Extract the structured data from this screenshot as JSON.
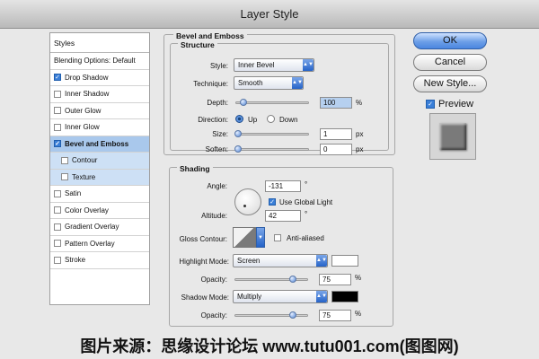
{
  "window": {
    "title": "Layer Style"
  },
  "styles_list": {
    "header": "Styles",
    "items": [
      {
        "label": "Blending Options: Default",
        "checkbox": false,
        "checked": false
      },
      {
        "label": "Drop Shadow",
        "checkbox": true,
        "checked": true
      },
      {
        "label": "Inner Shadow",
        "checkbox": true,
        "checked": false
      },
      {
        "label": "Outer Glow",
        "checkbox": true,
        "checked": false
      },
      {
        "label": "Inner Glow",
        "checkbox": true,
        "checked": false
      },
      {
        "label": "Bevel and Emboss",
        "checkbox": true,
        "checked": true,
        "selected": true
      },
      {
        "label": "Contour",
        "checkbox": true,
        "checked": false,
        "sub": true
      },
      {
        "label": "Texture",
        "checkbox": true,
        "checked": false,
        "sub": true
      },
      {
        "label": "Satin",
        "checkbox": true,
        "checked": false
      },
      {
        "label": "Color Overlay",
        "checkbox": true,
        "checked": false
      },
      {
        "label": "Gradient Overlay",
        "checkbox": true,
        "checked": false
      },
      {
        "label": "Pattern Overlay",
        "checkbox": true,
        "checked": false
      },
      {
        "label": "Stroke",
        "checkbox": true,
        "checked": false
      }
    ]
  },
  "bevel": {
    "group_title": "Bevel and Emboss",
    "structure_title": "Structure",
    "style_label": "Style:",
    "style_value": "Inner Bevel",
    "technique_label": "Technique:",
    "technique_value": "Smooth",
    "depth_label": "Depth:",
    "depth_value": "100",
    "depth_unit": "%",
    "direction_label": "Direction:",
    "direction_up": "Up",
    "direction_down": "Down",
    "size_label": "Size:",
    "size_value": "1",
    "size_unit": "px",
    "soften_label": "Soften:",
    "soften_value": "0",
    "soften_unit": "px"
  },
  "shading": {
    "title": "Shading",
    "angle_label": "Angle:",
    "angle_value": "-131",
    "angle_unit": "°",
    "global_light_label": "Use Global Light",
    "altitude_label": "Altitude:",
    "altitude_value": "42",
    "altitude_unit": "°",
    "gloss_label": "Gloss Contour:",
    "anti_aliased_label": "Anti-aliased",
    "highlight_mode_label": "Highlight Mode:",
    "highlight_mode_value": "Screen",
    "highlight_opacity_label": "Opacity:",
    "highlight_opacity_value": "75",
    "shadow_mode_label": "Shadow Mode:",
    "shadow_mode_value": "Multiply",
    "shadow_opacity_label": "Opacity:",
    "shadow_opacity_value": "75",
    "percent_unit": "%",
    "highlight_color": "#ffffff",
    "shadow_color": "#000000"
  },
  "buttons": {
    "ok": "OK",
    "cancel": "Cancel",
    "new_style": "New Style...",
    "preview_label": "Preview"
  },
  "watermark": "图片来源：思缘设计论坛 www.tutu001.com(图图网)"
}
